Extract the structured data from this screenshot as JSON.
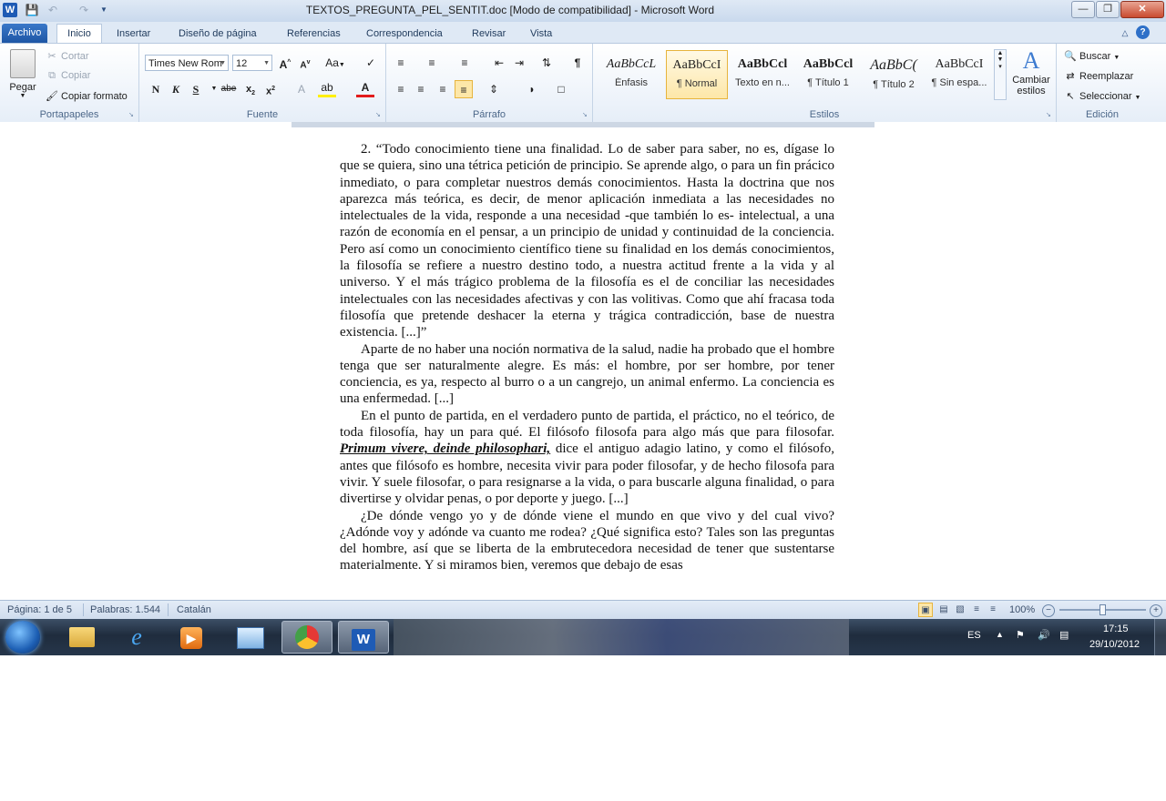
{
  "window": {
    "title": "TEXTOS_PREGUNTA_PEL_SENTIT.doc [Modo de compatibilidad]  -  Microsoft Word",
    "app_icon": "W"
  },
  "tabs": [
    "Archivo",
    "Inicio",
    "Insertar",
    "Diseño de página",
    "Referencias",
    "Correspondencia",
    "Revisar",
    "Vista"
  ],
  "ribbon": {
    "clipboard": {
      "paste": "Pegar",
      "cut": "Cortar",
      "copy": "Copiar",
      "format_painter": "Copiar formato",
      "label": "Portapapeles"
    },
    "font": {
      "family": "Times New Rom",
      "size": "12",
      "label": "Fuente",
      "grow": "A",
      "shrink": "A",
      "case": "Aa"
    },
    "paragraph": {
      "label": "Párrafo"
    },
    "styles": {
      "label": "Estilos",
      "items": [
        {
          "sample": "AaBbCcL",
          "name": "Énfasis"
        },
        {
          "sample": "AaBbCcI",
          "name": "¶ Normal"
        },
        {
          "sample": "AaBbCcl",
          "name": "Texto en n..."
        },
        {
          "sample": "AaBbCcl",
          "name": "¶ Título 1"
        },
        {
          "sample": "AaBbC(",
          "name": "¶ Título 2"
        },
        {
          "sample": "AaBbCcI",
          "name": "¶ Sin espa..."
        }
      ],
      "change_styles": "Cambiar estilos"
    },
    "editing": {
      "find": "Buscar",
      "replace": "Reemplazar",
      "select": "Seleccionar",
      "label": "Edición"
    }
  },
  "document": {
    "paragraphs": [
      "2. “Todo conocimiento tiene una finalidad. Lo de saber para saber, no es, dígase lo que se quiera, sino una tétrica petición de principio. Se aprende algo, o para un fin prácico inmediato, o para completar nuestros demás conocimientos. Hasta la doctrina que nos aparezca más teórica, es decir, de menor aplicación inmediata a las necesidades no intelectuales de la vida, responde a una necesidad -que también lo es- intelectual, a una razón de economía en el pensar, a un principio de unidad y continuidad de la conciencia. Pero así como un conocimiento científico tiene su finalidad en los demás conocimientos, la filosofía se refiere a nuestro destino todo, a nuestra actitud frente a la vida y al universo. Y el más trágico problema de la filosofía es el de conciliar las necesidades intelectuales con las necesidades afectivas y con las volitivas. Como que ahí fracasa toda filosofía que pretende deshacer la eterna y trágica contradicción, base de nuestra existencia. [...]”",
      "Aparte de no haber una noción normativa de la salud, nadie ha probado que el hombre tenga que ser naturalmente alegre. Es más: el hombre, por ser hombre, por tener conciencia, es ya, respecto al burro o a un cangrejo, un animal enfermo. La conciencia es una enfermedad. [...]"
    ],
    "p3_before": "En el punto de partida, en el verdadero punto de partida, el práctico, no el teórico, de toda filosofía, hay un para qué. El filósofo filosofa para algo más que para filosofar. ",
    "p3_emph": "Primum vivere, deinde philosophari,",
    "p3_after": " dice el antiguo adagio latino, y como el filósofo, antes que filósofo es hombre, necesita vivir para poder filosofar, y de hecho filosofa para vivir. Y suele filosofar, o para resignarse a la vida, o para buscarle alguna finalidad, o para divertirse y olvidar penas, o por deporte y juego. [...]",
    "p4": "¿De dónde vengo yo y de dónde viene el mundo en que vivo y del cual vivo? ¿Adónde voy y adónde va cuanto me rodea? ¿Qué significa esto? Tales son las preguntas del hombre, así que se liberta de la embrutecedora necesidad de tener que sustentarse materialmente. Y si miramos bien, veremos que debajo de esas"
  },
  "status": {
    "page": "Página: 1 de 5",
    "words": "Palabras: 1.544",
    "language": "Catalán",
    "zoom": "100%"
  },
  "taskbar": {
    "lang": "ES",
    "time": "17:15",
    "date": "29/10/2012"
  },
  "colors": {
    "accent": "#1e56a5",
    "selected_style": "#fde7a8"
  }
}
